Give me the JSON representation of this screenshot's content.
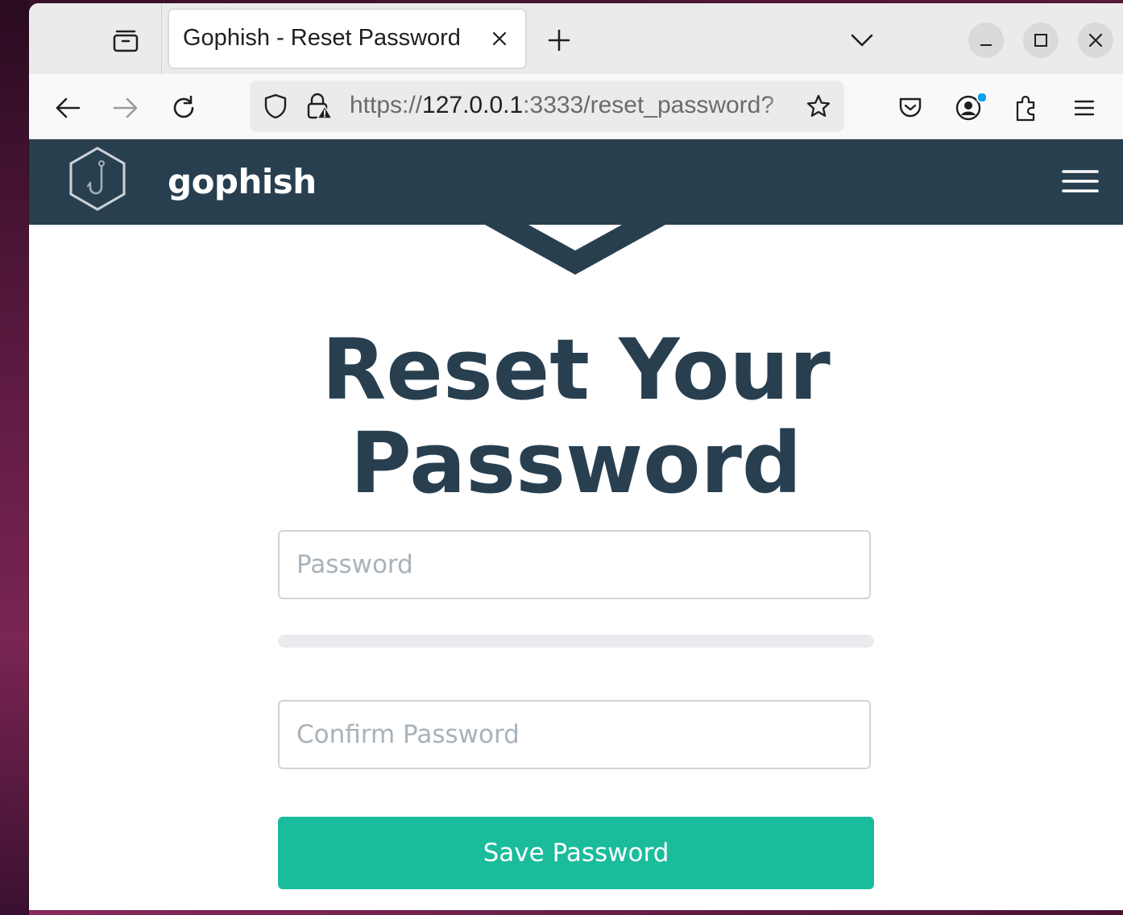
{
  "browser": {
    "tab": {
      "title": "Gophish - Reset Password"
    },
    "url": {
      "scheme": "https://",
      "host": "127.0.0.1",
      "rest": ":3333/reset_password?"
    }
  },
  "app": {
    "brand": "gophish"
  },
  "form": {
    "heading": "Reset Your Password",
    "password_placeholder": "Password",
    "confirm_placeholder": "Confirm Password",
    "password_strength": 0,
    "save_label": "Save Password"
  },
  "colors": {
    "navbar": "#283f50",
    "accent": "#1abc9c",
    "heading": "#283f50"
  },
  "icons": {
    "tab_list": "tab-list-icon",
    "tab_close": "close-icon",
    "new_tab": "plus-icon",
    "list_tabs": "chevron-down-icon",
    "minimize": "minimize-icon",
    "maximize": "maximize-icon",
    "close_window": "close-icon",
    "back": "arrow-left-icon",
    "forward": "arrow-right-icon",
    "reload": "reload-icon",
    "tracking_protection": "shield-icon",
    "connection": "insecure-lock-icon",
    "bookmark": "star-icon",
    "pocket": "pocket-icon",
    "account": "account-icon",
    "extensions": "puzzle-icon",
    "menu": "hamburger-icon",
    "logo": "gophish-hook-logo"
  }
}
